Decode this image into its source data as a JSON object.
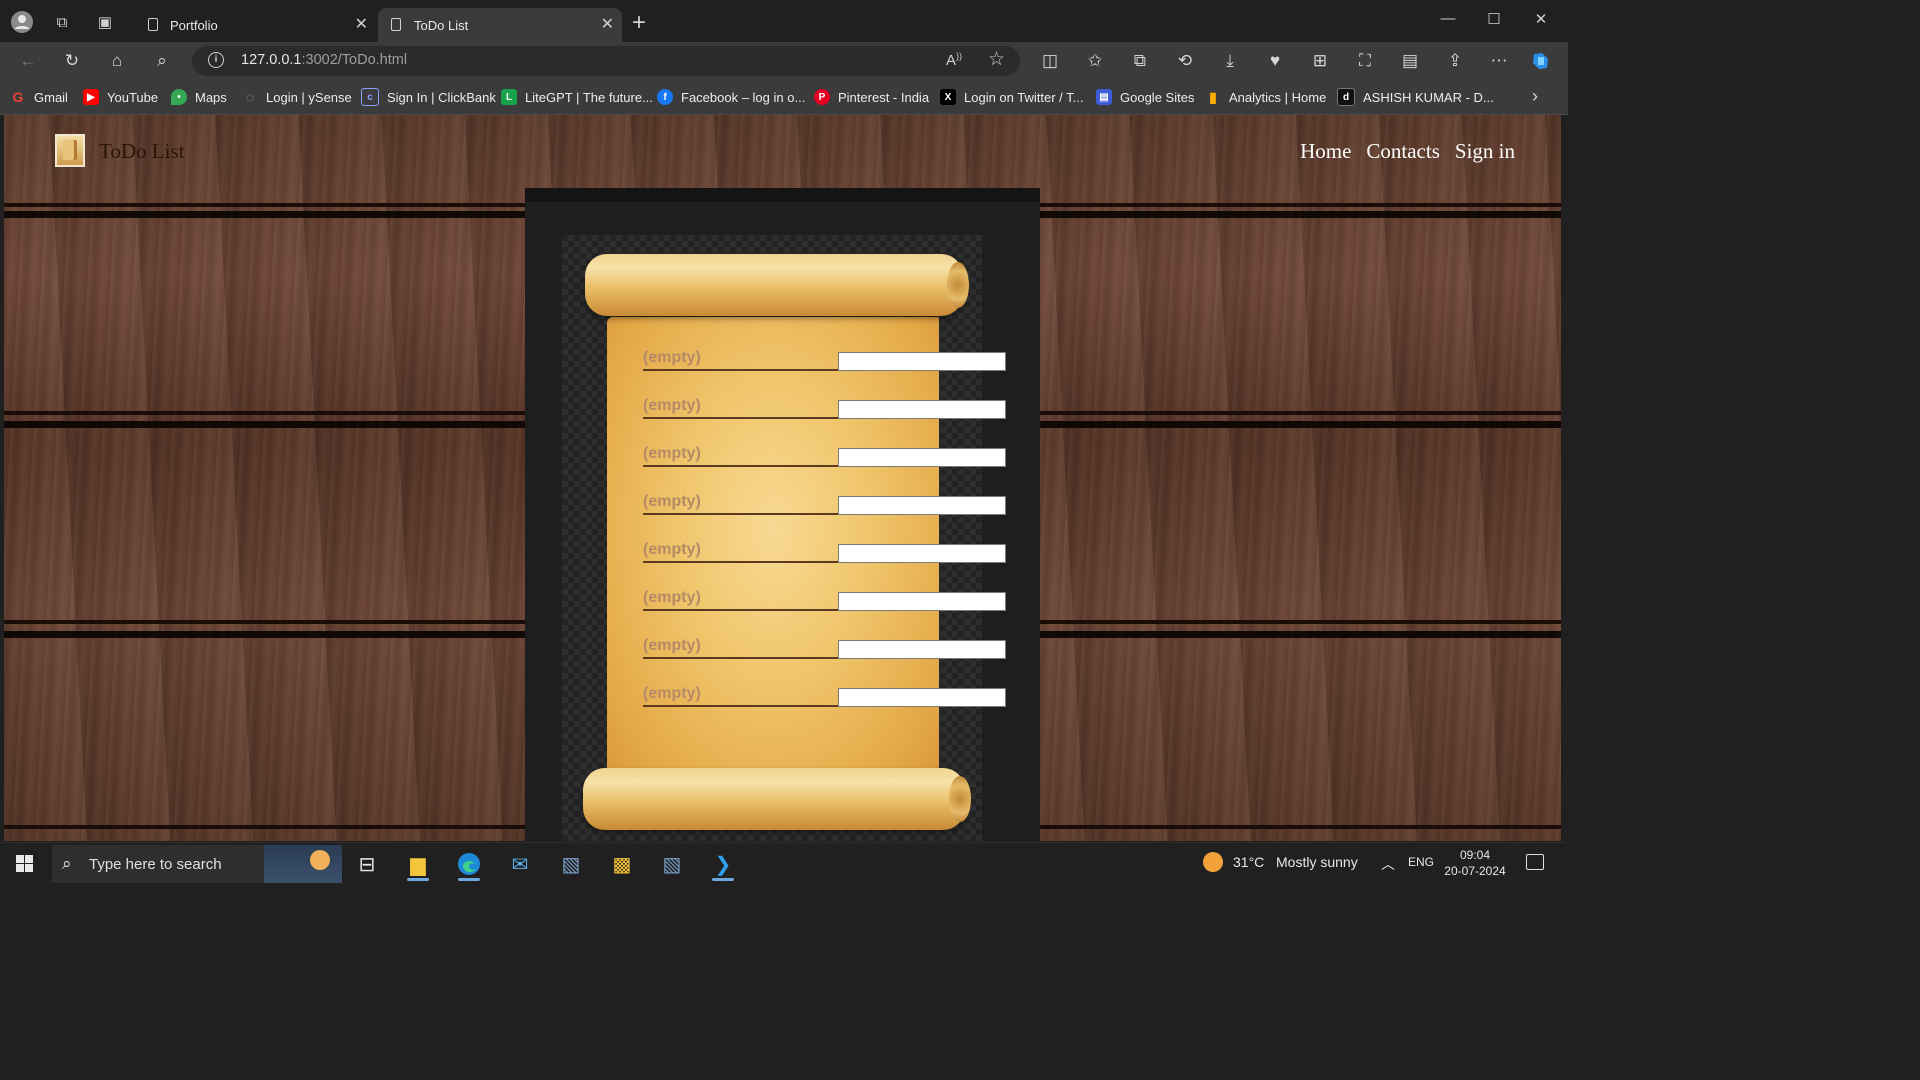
{
  "browser": {
    "tabs": [
      {
        "label": "Portfolio",
        "active": false
      },
      {
        "label": "ToDo List",
        "active": true
      }
    ],
    "url_host": "127.0.0.1",
    "url_rest": ":3002/ToDo.html"
  },
  "bookmarks": [
    {
      "label": "Gmail",
      "icon": "gmail-icon",
      "color": "#ea4335",
      "glyph": "G"
    },
    {
      "label": "YouTube",
      "icon": "youtube-icon",
      "color": "#ff0000",
      "glyph": "▶"
    },
    {
      "label": "Maps",
      "icon": "maps-icon",
      "color": "#34a853",
      "glyph": "⬤"
    },
    {
      "label": "Login | ySense",
      "icon": "ysense-icon",
      "color": "#7a7a7a",
      "glyph": "◌"
    },
    {
      "label": "Sign In | ClickBank",
      "icon": "clickbank-icon",
      "color": "#2a3e8c",
      "glyph": "c"
    },
    {
      "label": "LiteGPT | The future...",
      "icon": "litegpt-icon",
      "color": "#16a34a",
      "glyph": "L"
    },
    {
      "label": "Facebook – log in o...",
      "icon": "facebook-icon",
      "color": "#1877f2",
      "glyph": "f"
    },
    {
      "label": "Pinterest - India",
      "icon": "pinterest-icon",
      "color": "#e60023",
      "glyph": "P"
    },
    {
      "label": "Login on Twitter / T...",
      "icon": "x-icon",
      "color": "#000000",
      "glyph": "X"
    },
    {
      "label": "Google Sites",
      "icon": "google-sites-icon",
      "color": "#3b5bdb",
      "glyph": "▤"
    },
    {
      "label": "Analytics | Home",
      "icon": "analytics-icon",
      "color": "#f9ab00",
      "glyph": "▮"
    },
    {
      "label": "ASHISH KUMAR - D...",
      "icon": "digg-icon",
      "color": "#1a1a1a",
      "glyph": "d"
    }
  ],
  "site": {
    "title": "ToDo List",
    "nav": [
      "Home",
      "Contacts",
      "Sign in"
    ]
  },
  "todos": [
    {
      "label": "(empty)",
      "value": ""
    },
    {
      "label": "(empty)",
      "value": ""
    },
    {
      "label": "(empty)",
      "value": ""
    },
    {
      "label": "(empty)",
      "value": ""
    },
    {
      "label": "(empty)",
      "value": ""
    },
    {
      "label": "(empty)",
      "value": ""
    },
    {
      "label": "(empty)",
      "value": ""
    },
    {
      "label": "(empty)",
      "value": ""
    }
  ],
  "taskbar": {
    "search_placeholder": "Type here to search",
    "weather_temp": "31°C",
    "weather_text": "Mostly sunny",
    "language": "ENG",
    "time": "09:04",
    "date": "20-07-2024"
  }
}
